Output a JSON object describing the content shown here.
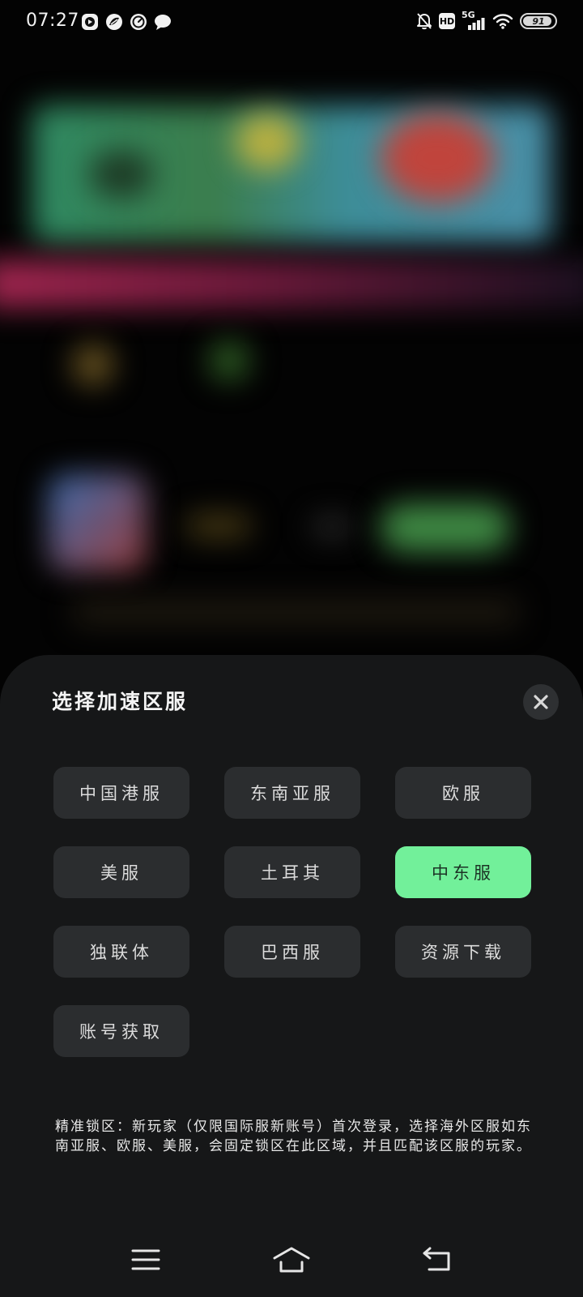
{
  "status_bar": {
    "time": "07:27",
    "network": "5G",
    "hd_label": "HD",
    "battery_level": "91",
    "battery_fraction": 0.91,
    "app_icons": [
      "video-app-icon",
      "leaf-app-icon",
      "speedometer-app-icon",
      "chat-bubble-icon"
    ]
  },
  "sheet": {
    "title": "选择加速区服",
    "close_icon": "close-icon",
    "regions": [
      {
        "label": "中国港服",
        "selected": false
      },
      {
        "label": "东南亚服",
        "selected": false
      },
      {
        "label": "欧服",
        "selected": false
      },
      {
        "label": "美服",
        "selected": false
      },
      {
        "label": "土耳其",
        "selected": false
      },
      {
        "label": "中东服",
        "selected": true
      },
      {
        "label": "独联体",
        "selected": false
      },
      {
        "label": "巴西服",
        "selected": false
      },
      {
        "label": "资源下载",
        "selected": false
      },
      {
        "label": "账号获取",
        "selected": false
      }
    ],
    "notice": "精准锁区：新玩家（仅限国际服新账号）首次登录，选择海外区服如东南亚服、欧服、美服，会固定锁区在此区域，并且匹配该区服的玩家。"
  },
  "nav_bar": {
    "icons": [
      "menu-icon",
      "home-icon",
      "back-icon"
    ]
  },
  "colors": {
    "sheet_bg": "#161718",
    "button_bg": "#2b2d2f",
    "selected_bg": "#72f09a",
    "selected_text": "#1c3325",
    "text": "#dcdcdc"
  }
}
